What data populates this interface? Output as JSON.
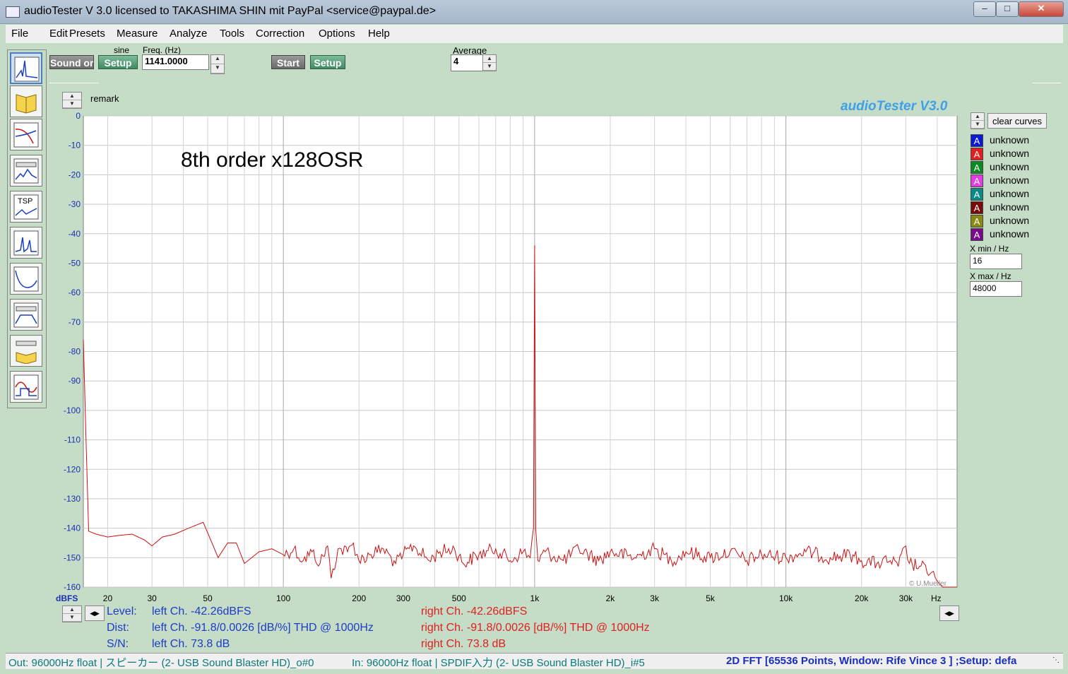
{
  "window": {
    "title": "audioTester  V 3.0   licensed to TAKASHIMA SHIN mit PayPal <service@paypal.de>",
    "min_icon": "minimize-icon",
    "max_icon": "maximize-icon",
    "close_icon": "close-icon"
  },
  "menu": [
    "File",
    "Edit",
    "Presets",
    "Measure",
    "Analyze",
    "Tools",
    "Correction",
    "Options",
    "Help"
  ],
  "toolbar": {
    "sound_button": "Sound or",
    "sine_label": "sine",
    "setup_label": "Setup",
    "freq_label": "Freq. (Hz)",
    "freq_value": "1141.0000",
    "start_label": "Start",
    "setup2_label": "Setup",
    "average_label": "Average",
    "average_value": "4"
  },
  "side_tools": [
    "fft-tool-icon",
    "book-tool-icon",
    "frequency-response-icon",
    "distortion-icon",
    "tsp-tool-icon",
    "spectrum-tool-icon",
    "impedance-icon",
    "filter-tool-icon",
    "record-tool-icon",
    "oscilloscope-icon"
  ],
  "tsp_text": "TSP",
  "chart": {
    "remark": "remark",
    "brand": "audioTester  V3.0",
    "annotation": "8th order x128OSR",
    "copyright": "© U.Mueller",
    "yunit": "dBFS",
    "xunit": "Hz",
    "clear_curves": "clear curves"
  },
  "chart_data": {
    "type": "line",
    "xscale": "log",
    "xlim": [
      16,
      48000
    ],
    "ylim": [
      -160,
      0
    ],
    "yticks": [
      0,
      -10,
      -20,
      -30,
      -40,
      -50,
      -60,
      -70,
      -80,
      -90,
      -100,
      -110,
      -120,
      -130,
      -140,
      -150,
      -160
    ],
    "ytick_labels": [
      "0",
      "-10",
      "-20",
      "-30",
      "-40",
      "-50",
      "-60",
      "-70",
      "-80",
      "-90",
      "-100",
      "-110",
      "-120",
      "-130",
      "-140",
      "-150",
      "-160"
    ],
    "xticks": [
      20,
      30,
      50,
      100,
      200,
      300,
      500,
      1000,
      2000,
      3000,
      5000,
      10000,
      20000,
      30000
    ],
    "xtick_labels": [
      "20",
      "30",
      "50",
      "100",
      "200",
      "300",
      "500",
      "1k",
      "2k",
      "3k",
      "5k",
      "10k",
      "20k",
      "30k"
    ],
    "grid": true,
    "series": [
      {
        "color": "#cc1111",
        "points": [
          [
            16,
            -76
          ],
          [
            16.4,
            -110
          ],
          [
            16.8,
            -141
          ],
          [
            18,
            -142
          ],
          [
            20,
            -143
          ],
          [
            22,
            -142.5
          ],
          [
            25,
            -142
          ],
          [
            28,
            -144
          ],
          [
            30,
            -146
          ],
          [
            33,
            -143
          ],
          [
            37,
            -142
          ],
          [
            42,
            -140
          ],
          [
            48,
            -138
          ],
          [
            52,
            -145
          ],
          [
            55,
            -150
          ],
          [
            60,
            -145
          ],
          [
            65,
            -145
          ],
          [
            70,
            -152
          ],
          [
            80,
            -148
          ],
          [
            90,
            -147
          ],
          [
            100,
            -149
          ],
          [
            110,
            -147
          ],
          [
            120,
            -151
          ],
          [
            130,
            -148
          ],
          [
            140,
            -152
          ],
          [
            150,
            -146
          ],
          [
            155,
            -157
          ],
          [
            165,
            -147
          ],
          [
            180,
            -148
          ],
          [
            190,
            -145
          ],
          [
            200,
            -151
          ],
          [
            220,
            -149
          ],
          [
            250,
            -147
          ],
          [
            280,
            -152
          ],
          [
            300,
            -149
          ],
          [
            330,
            -146
          ],
          [
            380,
            -151
          ],
          [
            420,
            -148
          ],
          [
            480,
            -147
          ],
          [
            520,
            -152
          ],
          [
            600,
            -149
          ],
          [
            700,
            -147
          ],
          [
            800,
            -151
          ],
          [
            900,
            -148
          ],
          [
            960,
            -150
          ],
          [
            990,
            -140
          ],
          [
            1000,
            -44
          ],
          [
            1010,
            -140
          ],
          [
            1030,
            -151
          ],
          [
            1100,
            -148
          ],
          [
            1300,
            -151
          ],
          [
            1500,
            -147
          ],
          [
            1800,
            -151
          ],
          [
            2000,
            -148
          ],
          [
            2500,
            -150
          ],
          [
            3000,
            -147
          ],
          [
            3500,
            -151
          ],
          [
            4000,
            -148
          ],
          [
            5000,
            -150
          ],
          [
            6000,
            -148
          ],
          [
            7000,
            -151
          ],
          [
            8000,
            -149
          ],
          [
            10000,
            -150
          ],
          [
            12000,
            -148
          ],
          [
            15000,
            -150
          ],
          [
            18000,
            -149
          ],
          [
            20000,
            -151
          ],
          [
            23000,
            -152
          ],
          [
            26000,
            -151
          ],
          [
            28000,
            -153
          ],
          [
            30000,
            -146
          ],
          [
            31000,
            -152
          ],
          [
            34000,
            -153
          ],
          [
            38000,
            -155
          ],
          [
            40000,
            -158
          ],
          [
            41000,
            -159
          ],
          [
            42000,
            -160
          ],
          [
            48000,
            -160
          ]
        ]
      }
    ]
  },
  "legend": [
    {
      "label": "unknown",
      "color": "#0a18d8"
    },
    {
      "label": "unknown",
      "color": "#e02020"
    },
    {
      "label": "unknown",
      "color": "#0a8a22"
    },
    {
      "label": "unknown",
      "color": "#e040e0"
    },
    {
      "label": "unknown",
      "color": "#0a8a86"
    },
    {
      "label": "unknown",
      "color": "#7a0a0a"
    },
    {
      "label": "unknown",
      "color": "#8a8a10"
    },
    {
      "label": "unknown",
      "color": "#7a0a8a"
    }
  ],
  "legend_glyph": "A",
  "xrange": {
    "min_label": "X min / Hz",
    "min_value": "16",
    "max_label": "X max / Hz",
    "max_value": "48000"
  },
  "stats": {
    "level_label": "Level:",
    "dist_label": "Dist:",
    "sn_label": "S/N:",
    "level_left": "left Ch. -42.26dBFS",
    "dist_left": "left Ch. -91.8/0.0026 [dB/%] THD @ 1000Hz",
    "sn_left": "left Ch. 73.8 dB",
    "level_right": "right Ch. -42.26dBFS",
    "dist_right": "right Ch. -91.8/0.0026 [dB/%] THD @ 1000Hz",
    "sn_right": "right Ch. 73.8 dB"
  },
  "status": {
    "out": "Out: 96000Hz float  | スピーカー (2- USB Sound Blaster HD)_o#0",
    "in": "In: 96000Hz float  | SPDIF入力 (2- USB Sound Blaster HD)_i#5",
    "mode": "2D FFT [65536 Points, Window: Rife Vince 3 ]  ;Setup:  defa"
  }
}
